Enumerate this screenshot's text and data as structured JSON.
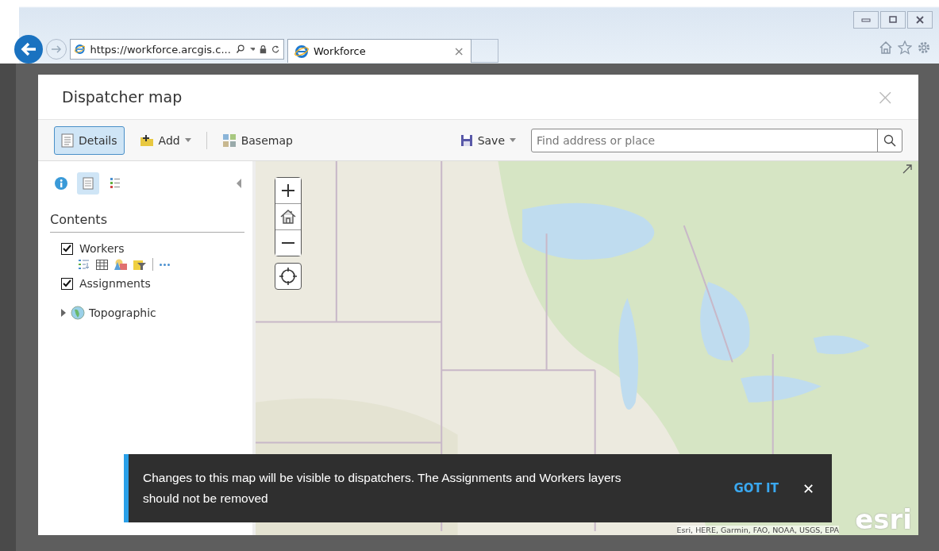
{
  "browser": {
    "address": "https://workforce.arcgis.c...",
    "tab": "Workforce",
    "tab_close": "×"
  },
  "dialog": {
    "title": "Dispatcher map",
    "close": "×"
  },
  "toolbar": {
    "buttons": [
      {
        "label": "Details",
        "kind": "details",
        "selected": true
      },
      {
        "label": "Add",
        "kind": "add",
        "selected": false
      },
      {
        "label": "Basemap",
        "kind": "basemap",
        "selected": false
      }
    ],
    "save": "Save",
    "search": {
      "placeholder": "Find address or place"
    }
  },
  "sidebar": {
    "tabs": [
      {
        "kind": "about",
        "selected": false
      },
      {
        "kind": "content",
        "selected": true
      },
      {
        "kind": "legend",
        "selected": false
      }
    ],
    "heading": "Contents",
    "layers": [
      {
        "label": "Workers",
        "checked": true,
        "tools": true
      },
      {
        "label": "Assignments",
        "checked": true,
        "tools": false
      }
    ],
    "basemap": {
      "label": "Topographic",
      "expanded": false
    }
  },
  "map": {
    "kind": "picture",
    "toast": {
      "message": "Changes to this map will be visible to dispatchers. The Assignments and Workers layers should not be removed",
      "action": "GOT IT",
      "close": "✕"
    },
    "attribution": "Esri, HERE, Garmin, FAO, NOAA, USGS, EPA",
    "logo": "esri"
  }
}
